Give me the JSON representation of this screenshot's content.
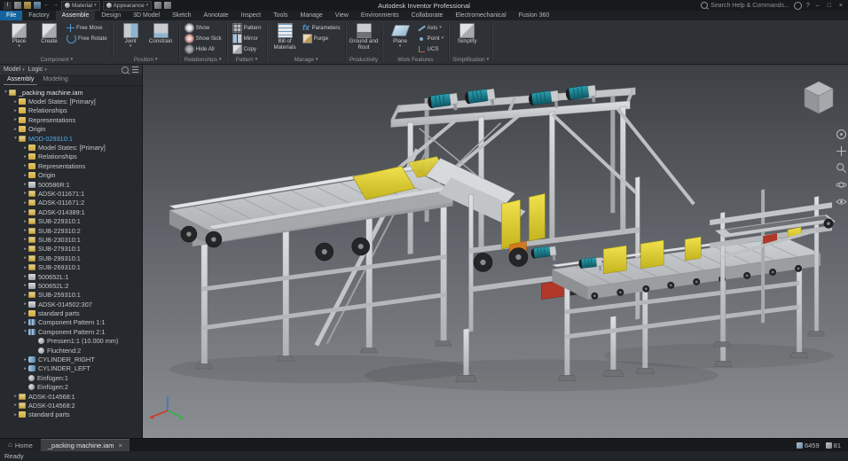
{
  "titlebar": {
    "app_title": "Autodesk Inventor Professional",
    "search_placeholder": "Search Help & Commands...",
    "material_select": "Material",
    "appearance_select": "Appearance",
    "window_buttons": {
      "minimize": "–",
      "maximize": "□",
      "close": "×"
    }
  },
  "ribbon": {
    "tabs": [
      {
        "label": "File",
        "state": "file"
      },
      {
        "label": "Factory"
      },
      {
        "label": "Assemble",
        "state": "active"
      },
      {
        "label": "Design"
      },
      {
        "label": "3D Model"
      },
      {
        "label": "Sketch"
      },
      {
        "label": "Annotate"
      },
      {
        "label": "Inspect"
      },
      {
        "label": "Tools"
      },
      {
        "label": "Manage"
      },
      {
        "label": "View"
      },
      {
        "label": "Environments"
      },
      {
        "label": "Collaborate"
      },
      {
        "label": "Electromechanical"
      },
      {
        "label": "Fusion 360"
      }
    ],
    "groups": [
      {
        "label": "Component",
        "menu_arrow": true,
        "big": [
          {
            "label": "Place",
            "icon": "place",
            "arrow": true
          },
          {
            "label": "Create",
            "icon": "create"
          }
        ],
        "small": [
          {
            "label": "Free Move",
            "icon": "free-move"
          },
          {
            "label": "Free Rotate",
            "icon": "free-rotate"
          }
        ]
      },
      {
        "label": "Position",
        "menu_arrow": true,
        "big": [
          {
            "label": "Joint",
            "icon": "joint",
            "arrow": true
          },
          {
            "label": "Constrain",
            "icon": "constrain"
          }
        ],
        "small": []
      },
      {
        "label": "Relationships",
        "menu_arrow": true,
        "big": [],
        "small": [
          {
            "label": "Show",
            "icon": "show"
          },
          {
            "label": "Show Sick",
            "icon": "show-sick"
          },
          {
            "label": "Hide All",
            "icon": "hide-all"
          }
        ]
      },
      {
        "label": "Pattern",
        "menu_arrow": true,
        "big": [],
        "small": [
          {
            "label": "Pattern",
            "icon": "pattern"
          },
          {
            "label": "Mirror",
            "icon": "mirror"
          },
          {
            "label": "Copy",
            "icon": "copy"
          }
        ]
      },
      {
        "label": "Manage",
        "menu_arrow": true,
        "big": [
          {
            "label": "Bill of Materials",
            "icon": "bom"
          }
        ],
        "small": [
          {
            "label": "Parameters",
            "icon": "fx"
          },
          {
            "label": "Purge",
            "icon": "purge"
          }
        ]
      },
      {
        "label": "Productivity",
        "menu_arrow": false,
        "big": [
          {
            "label": "Ground and Root",
            "icon": "ground"
          }
        ],
        "small": []
      },
      {
        "label": "Work Features",
        "menu_arrow": false,
        "big": [
          {
            "label": "Plane",
            "icon": "plane",
            "arrow": true
          }
        ],
        "small": [
          {
            "label": "Axis",
            "icon": "axis",
            "arrow": true
          },
          {
            "label": "Point",
            "icon": "point",
            "arrow": true
          },
          {
            "label": "UCS",
            "icon": "ucs"
          }
        ]
      },
      {
        "label": "Simplification",
        "menu_arrow": true,
        "big": [
          {
            "label": "Simplify",
            "icon": "simplify"
          }
        ],
        "small": []
      }
    ]
  },
  "browser": {
    "pane_label": "Model",
    "logic_label": "Logic",
    "tabs": [
      {
        "label": "Assembly",
        "active": true
      },
      {
        "label": "Modeling",
        "active": false
      }
    ],
    "tree": [
      {
        "t": "_packing machine.iam",
        "l": 0,
        "i": "asm",
        "e": "o",
        "c": "root"
      },
      {
        "t": "Model States: [Primary]",
        "l": 1,
        "i": "fold",
        "e": "c"
      },
      {
        "t": "Relationships",
        "l": 1,
        "i": "fold",
        "e": "c"
      },
      {
        "t": "Representations",
        "l": 1,
        "i": "fold",
        "e": "c"
      },
      {
        "t": "Origin",
        "l": 1,
        "i": "fold",
        "e": "c"
      },
      {
        "t": "MOD-029310:1",
        "l": 1,
        "i": "asm",
        "e": "o",
        "c": "hl"
      },
      {
        "t": "Model States: [Primary]",
        "l": 2,
        "i": "fold",
        "e": "c"
      },
      {
        "t": "Relationships",
        "l": 2,
        "i": "fold",
        "e": "c"
      },
      {
        "t": "Representations",
        "l": 2,
        "i": "fold",
        "e": "c"
      },
      {
        "t": "Origin",
        "l": 2,
        "i": "fold",
        "e": "c"
      },
      {
        "t": "500586R:1",
        "l": 2,
        "i": "part",
        "e": "c"
      },
      {
        "t": "ADSK-011671:1",
        "l": 2,
        "i": "asm",
        "e": "c"
      },
      {
        "t": "ADSK-011671:2",
        "l": 2,
        "i": "asm",
        "e": "c"
      },
      {
        "t": "ADSK-014389:1",
        "l": 2,
        "i": "asm",
        "e": "c"
      },
      {
        "t": "SUB-229310:1",
        "l": 2,
        "i": "asm",
        "e": "c"
      },
      {
        "t": "SUB-229310:2",
        "l": 2,
        "i": "asm",
        "e": "c"
      },
      {
        "t": "SUB-230310:1",
        "l": 2,
        "i": "asm",
        "e": "c"
      },
      {
        "t": "SUB-279310:1",
        "l": 2,
        "i": "asm",
        "e": "c"
      },
      {
        "t": "SUB-299310:1",
        "l": 2,
        "i": "asm",
        "e": "c"
      },
      {
        "t": "SUB-269310:1",
        "l": 2,
        "i": "asm",
        "e": "c"
      },
      {
        "t": "500652L:1",
        "l": 2,
        "i": "part",
        "e": "c"
      },
      {
        "t": "500652L:2",
        "l": 2,
        "i": "part",
        "e": "c"
      },
      {
        "t": "SUB-259310:1",
        "l": 2,
        "i": "asm",
        "e": "c"
      },
      {
        "t": "ADSK-014502:307",
        "l": 2,
        "i": "part",
        "e": "c"
      },
      {
        "t": "standard parts",
        "l": 2,
        "i": "fold",
        "e": "c"
      },
      {
        "t": "Component Pattern 1:1",
        "l": 2,
        "i": "pat",
        "e": "c"
      },
      {
        "t": "Component Pattern 2:1",
        "l": 2,
        "i": "pat",
        "e": "o"
      },
      {
        "t": "Pressen1:1 (10.000 mm)",
        "l": 3,
        "i": "con",
        "e": "n"
      },
      {
        "t": "Fluchtend:2",
        "l": 3,
        "i": "con",
        "e": "n"
      },
      {
        "t": "CYLINDER_RIGHT",
        "l": 2,
        "i": "cyl",
        "e": "c"
      },
      {
        "t": "CYLINDER_LEFT",
        "l": 2,
        "i": "cyl",
        "e": "c"
      },
      {
        "t": "Einfügen:1",
        "l": 2,
        "i": "con",
        "e": "n"
      },
      {
        "t": "Einfügen:2",
        "l": 2,
        "i": "con",
        "e": "n"
      },
      {
        "t": "ADSK-014568:1",
        "l": 1,
        "i": "asm",
        "e": "c"
      },
      {
        "t": "ADSK-014568:2",
        "l": 1,
        "i": "asm",
        "e": "c"
      },
      {
        "t": "standard parts",
        "l": 1,
        "i": "fold",
        "e": "c"
      }
    ]
  },
  "viewport": {
    "nav_tools": [
      "navigation-wheel",
      "pan",
      "zoom",
      "orbit",
      "look-at"
    ]
  },
  "doc_tabs": {
    "home_label": "Home",
    "active_doc": "_packing machine.iam",
    "close_glyph": "×",
    "counters": [
      {
        "icon": "occurrence-count-icon",
        "value": "6459"
      },
      {
        "icon": "file-count-icon",
        "value": "81"
      }
    ]
  },
  "statusbar": {
    "ready": "Ready"
  },
  "colors": {
    "file_tab_blue": "#15639e",
    "highlight_blue": "#58b0f0",
    "machine_yellow": "#e0d030",
    "motor_teal": "#17727f",
    "viewport_top": "#3c4044",
    "viewport_bottom": "#8b8f93"
  }
}
